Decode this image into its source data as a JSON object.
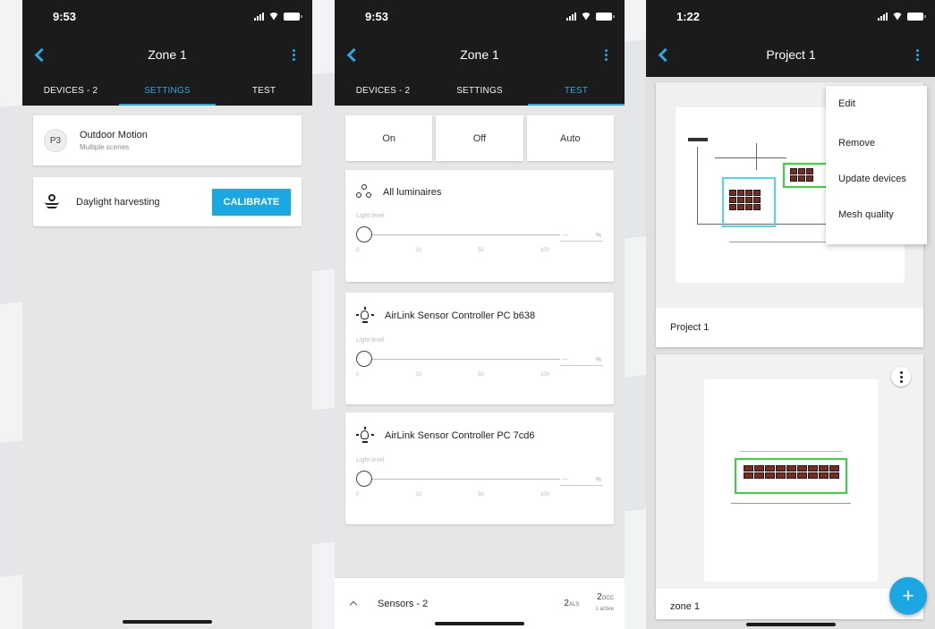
{
  "colors": {
    "accent": "#1ba7e2",
    "bar": "#1b1b1b",
    "zone_green": "#38d43c",
    "zone_cyan": "#52d6e8"
  },
  "screen1": {
    "time": "9:53",
    "title": "Zone 1",
    "tabs": [
      "DEVICES - 2",
      "SETTINGS",
      "TEST"
    ],
    "active_tab": "SETTINGS",
    "scene": {
      "badge": "P3",
      "name": "Outdoor Motion",
      "subtitle": "Multiple scenes"
    },
    "daylight": {
      "label": "Daylight harvesting",
      "button": "CALIBRATE"
    }
  },
  "screen2": {
    "time": "9:53",
    "title": "Zone 1",
    "tabs": [
      "DEVICES - 2",
      "SETTINGS",
      "TEST"
    ],
    "active_tab": "TEST",
    "modes": [
      "On",
      "Off",
      "Auto"
    ],
    "devices": [
      {
        "icon": "luminaires-icon",
        "name": "All luminaires",
        "slider_label": "Light level",
        "value_placeholder": "---",
        "unit": "%",
        "level": 0,
        "ticks": [
          "0",
          "10",
          "50",
          "100"
        ]
      },
      {
        "icon": "bulb-icon",
        "name": "AirLink Sensor Controller PC b638",
        "slider_label": "Light level",
        "value_placeholder": "---",
        "unit": "%",
        "level": 0,
        "ticks": [
          "0",
          "10",
          "50",
          "100"
        ]
      },
      {
        "icon": "bulb-icon",
        "name": "AirLink Sensor Controller PC 7cd6",
        "slider_label": "Light level",
        "value_placeholder": "---",
        "unit": "%",
        "level": 0,
        "ticks": [
          "0",
          "10",
          "50",
          "100"
        ]
      }
    ],
    "sensors": {
      "label": "Sensors - 2",
      "als_count": "2",
      "als_unit": "ALS",
      "occ_count": "2",
      "occ_unit": "OCC",
      "occ_active": "1 active"
    }
  },
  "screen3": {
    "time": "1:22",
    "title": "Project 1",
    "cards": [
      {
        "label": "Project 1"
      },
      {
        "label": "zone 1"
      }
    ],
    "menu": [
      "Edit",
      "Remove",
      "Update devices",
      "Mesh quality"
    ],
    "fab_label": "+"
  }
}
